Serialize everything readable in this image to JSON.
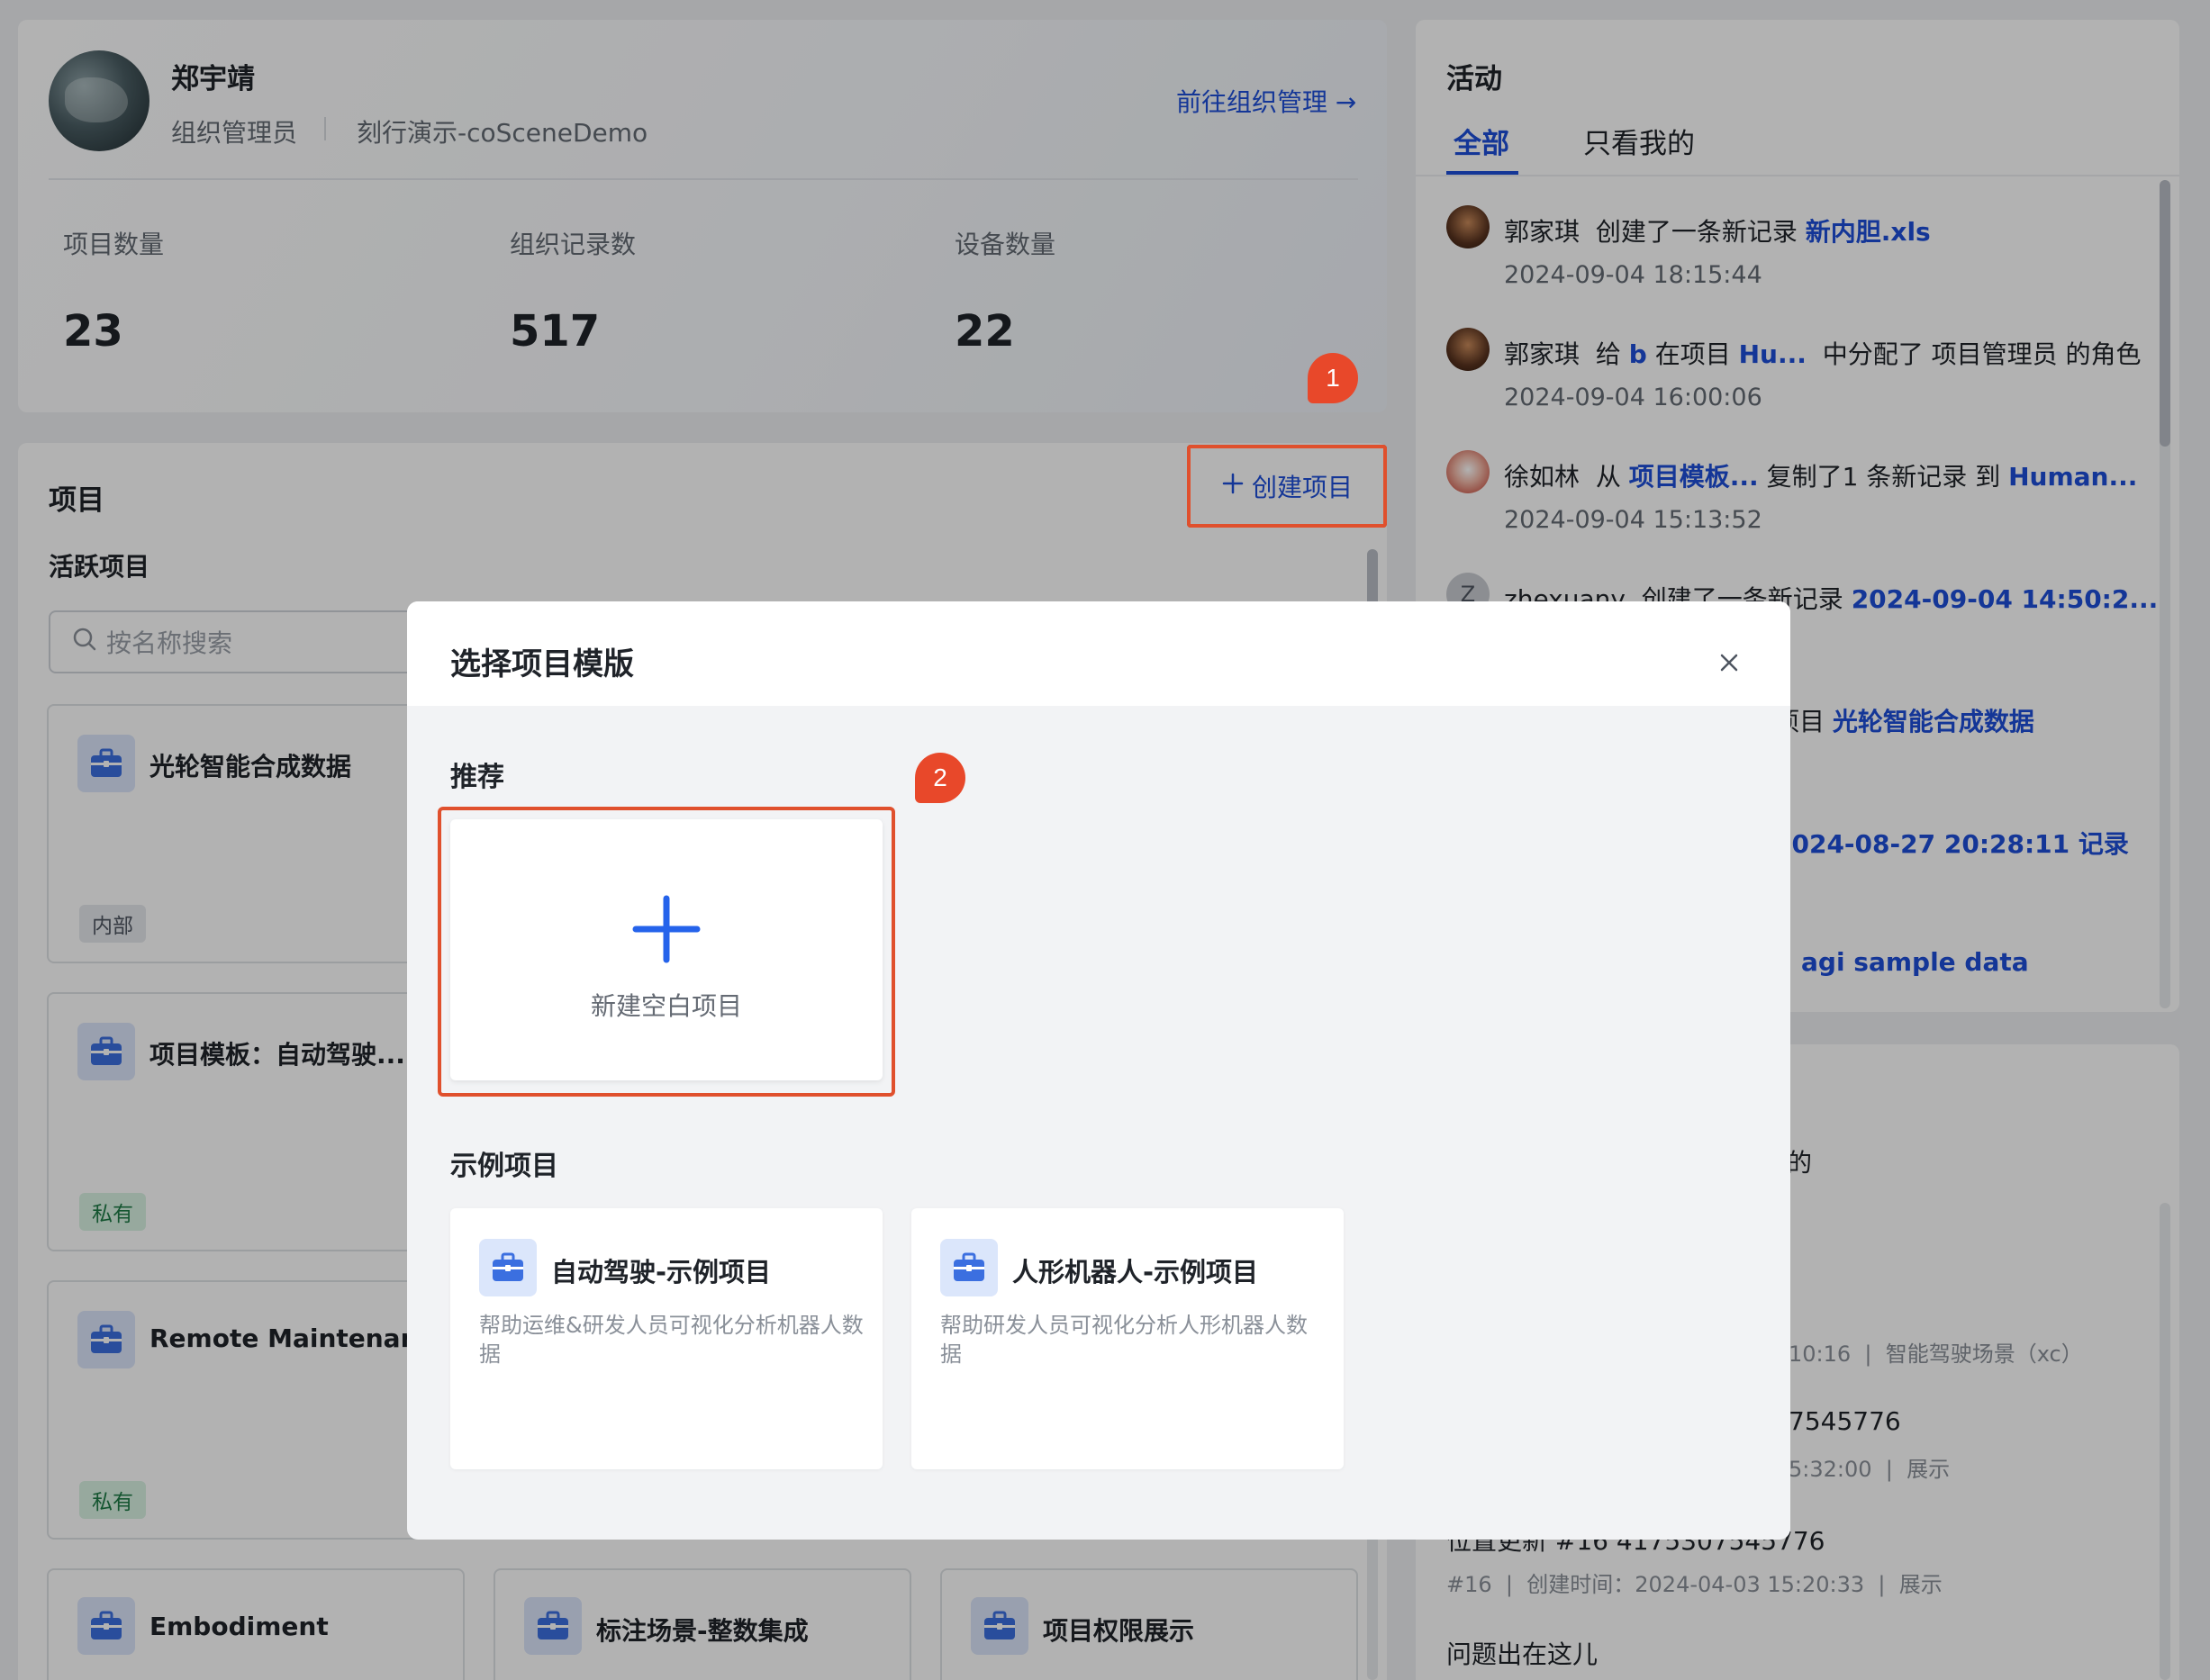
{
  "profile": {
    "name": "郑宇靖",
    "role": "组织管理员",
    "org": "刻行演示-coSceneDemo",
    "manage_link": "前往组织管理 →",
    "stats": [
      {
        "label": "项目数量",
        "value": "23"
      },
      {
        "label": "组织记录数",
        "value": "517"
      },
      {
        "label": "设备数量",
        "value": "22"
      }
    ]
  },
  "projects": {
    "title": "项目",
    "create_button": "创建项目",
    "active_title": "活跃项目",
    "search_placeholder": "按名称搜索",
    "cards": [
      {
        "name": "光轮智能合成数据",
        "tag": "内部"
      },
      {
        "name": "项目模板：自动驾驶...",
        "tag": "私有"
      },
      {
        "name": "Remote Maintenance",
        "tag": "私有"
      },
      {
        "name": "Embodiment"
      },
      {
        "name": "标注场景-整数集成"
      },
      {
        "name": "项目权限展示"
      }
    ]
  },
  "activity": {
    "title": "活动",
    "tabs": [
      "全部",
      "只看我的"
    ],
    "items": [
      {
        "user": "郭家琪",
        "action": "创建了一条新记录",
        "link": "新内胆.xls",
        "time": "2024-09-04 18:15:44"
      },
      {
        "user": "郭家琪",
        "pre": "给",
        "link1": "b",
        "mid": "在项目",
        "link2": "Hu...",
        "post": "中分配了 项目管理员 的角色",
        "time": "2024-09-04 16:00:06"
      },
      {
        "user": "徐如林",
        "pre": "从",
        "link1": "项目模板...",
        "mid": "复制了1 条新记录 到",
        "link2": "Human...",
        "time": "2024-09-04 15:13:52"
      },
      {
        "user": "zhexuany",
        "avatar_letter": "Z",
        "action": "创建了一条新记录",
        "link": "2024-09-04 14:50:2..."
      },
      {
        "fragment": "项目",
        "link": "光轮智能合成数据"
      },
      {
        "link": "2024-08-27 20:28:11 记录"
      },
      {
        "link": "agi sample data"
      }
    ]
  },
  "records": {
    "fragment_tab": "的",
    "rows": [
      {
        "meta_time": "10:16",
        "meta_project": "智能驾驶场景（xc）"
      },
      {
        "title_frag": "7545776",
        "meta_time": "5:32:00",
        "meta_tag": "展示"
      },
      {
        "title": "位置更新 #16 4175307545776",
        "meta_id": "#16",
        "meta_time": "创建时间：2024-04-03 15:20:33",
        "meta_tag": "展示"
      },
      {
        "title": "问题出在这儿"
      }
    ]
  },
  "modal": {
    "title": "选择项目模版",
    "section_recommend": "推荐",
    "blank_label": "新建空白项目",
    "section_examples": "示例项目",
    "examples": [
      {
        "name": "自动驾驶-示例项目",
        "desc": "帮助运维&研发人员可视化分析机器人数据"
      },
      {
        "name": "人形机器人-示例项目",
        "desc": "帮助研发人员可视化分析人形机器人数据"
      }
    ]
  },
  "badges": [
    "1",
    "2"
  ],
  "colors": {
    "accent": "#1d4ed8",
    "highlight": "#e0502d",
    "private_tag": "#1e7a45"
  }
}
